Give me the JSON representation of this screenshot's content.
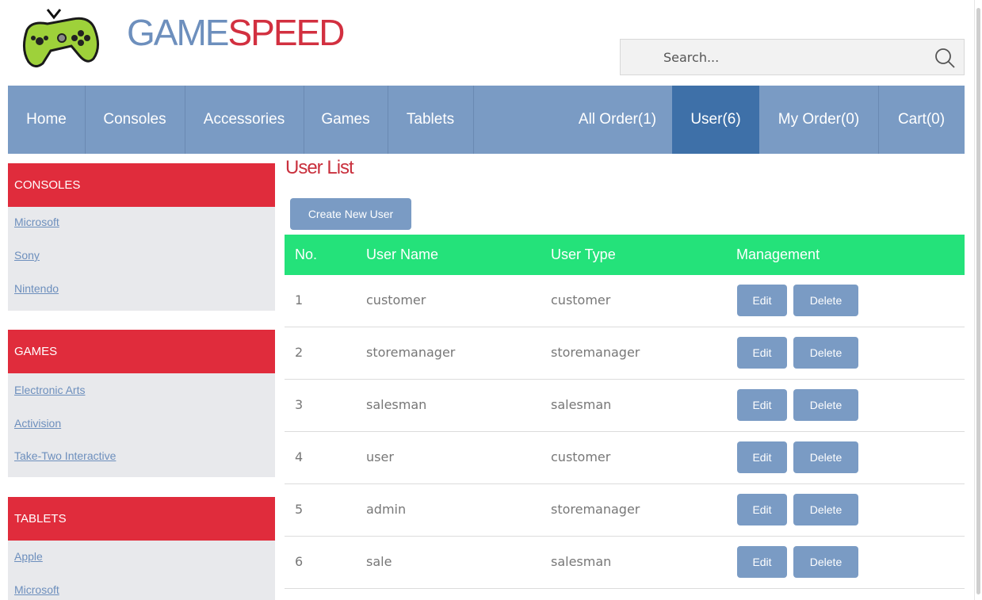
{
  "brand": {
    "part1": "GAME",
    "part2": "SPEED"
  },
  "search": {
    "placeholder": "Search..."
  },
  "nav": {
    "left": [
      "Home",
      "Consoles",
      "Accessories",
      "Games",
      "Tablets"
    ],
    "right": [
      "All Order(1)",
      "User(6)",
      "My Order(0)",
      "Cart(0)"
    ],
    "active": "User(6)"
  },
  "sidebar": {
    "sections": [
      {
        "title": "CONSOLES",
        "links": [
          "Microsoft",
          "Sony",
          "Nintendo"
        ]
      },
      {
        "title": "GAMES",
        "links": [
          "Electronic Arts",
          "Activision",
          "Take-Two Interactive"
        ]
      },
      {
        "title": "TABLETS",
        "links": [
          "Apple",
          "Microsoft"
        ]
      }
    ]
  },
  "main": {
    "title": "User List",
    "create_label": "Create New User",
    "columns": [
      "No.",
      "User Name",
      "User Type",
      "Management"
    ],
    "edit_label": "Edit",
    "delete_label": "Delete",
    "rows": [
      {
        "no": "1",
        "name": "customer",
        "type": "customer"
      },
      {
        "no": "2",
        "name": "storemanager",
        "type": "storemanager"
      },
      {
        "no": "3",
        "name": "salesman",
        "type": "salesman"
      },
      {
        "no": "4",
        "name": "user",
        "type": "customer"
      },
      {
        "no": "5",
        "name": "admin",
        "type": "storemanager"
      },
      {
        "no": "6",
        "name": "sale",
        "type": "salesman"
      }
    ]
  },
  "colors": {
    "nav": "#7a9bc4",
    "nav_active": "#3e70a8",
    "sidebar_header": "#e02c3c",
    "table_header": "#24e27a",
    "title": "#c9303d"
  },
  "icons": {
    "logo": "gamepad-icon",
    "search": "search-icon"
  }
}
